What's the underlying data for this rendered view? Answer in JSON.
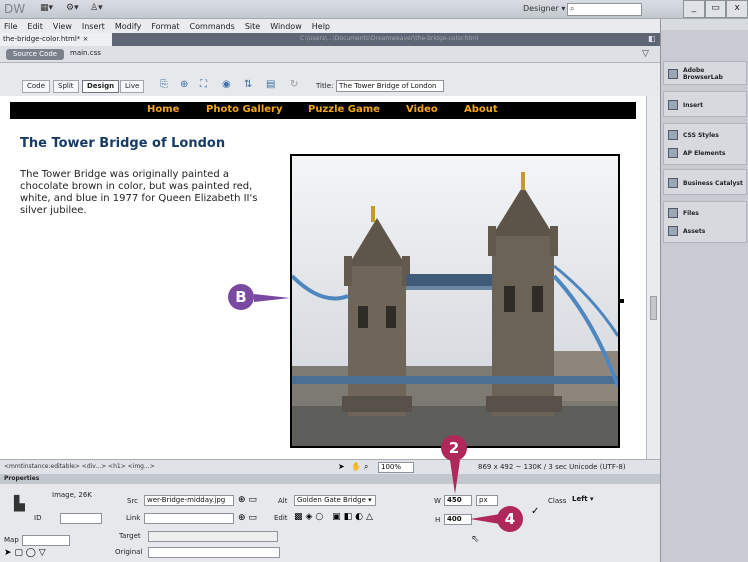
{
  "titlebar": {
    "logo": "DW",
    "designer": "Designer",
    "window_buttons": [
      "_",
      "▭",
      "x"
    ]
  },
  "menu": [
    "File",
    "Edit",
    "View",
    "Insert",
    "Modify",
    "Format",
    "Commands",
    "Site",
    "Window",
    "Help"
  ],
  "doc_tab": "the-bridge-color.html*",
  "related": {
    "source_code": "Source Code",
    "css_file": "main.css"
  },
  "doc_toolbar": {
    "code": "Code",
    "split": "Split",
    "design": "Design",
    "live": "Live",
    "title_label": "Title:",
    "title_value": "The Tower Bridge of London"
  },
  "page": {
    "nav": [
      "Home",
      "Photo Gallery",
      "Puzzle Game",
      "Video",
      "About"
    ],
    "heading": "The Tower Bridge of London",
    "paragraph": "The Tower Bridge was originally painted a chocolate brown in color, but was painted red, white, and blue in 1977 for Queen Elizabeth II's silver jubilee."
  },
  "status": {
    "tags": "<mmtinstance:editable> <div...> <h1> <img...>",
    "zoom": "100%",
    "dimensions": "869 x 492 ~ 130K / 3 sec  Unicode (UTF-8)"
  },
  "properties": {
    "title": "Properties",
    "type_label": "Image, 26K",
    "src_label": "Src",
    "src_value": "wer-Bridge-midday.jpg",
    "alt_label": "Alt",
    "alt_value": "Golden Gate Bridge",
    "id_label": "ID",
    "link_label": "Link",
    "edit_label": "Edit",
    "w_label": "W",
    "w_value": "450",
    "w_unit": "px",
    "h_label": "H",
    "h_value": "400",
    "class_label": "Class",
    "class_value": "Left",
    "map_label": "Map",
    "target_label": "Target",
    "original_label": "Original"
  },
  "right_panel": {
    "items": [
      "Adobe BrowserLab",
      "Insert",
      "CSS Styles",
      "AP Elements",
      "Business Catalyst",
      "Files",
      "Assets"
    ]
  },
  "callouts": {
    "b": "B",
    "two": "2",
    "four": "4"
  },
  "colors": {
    "accent": "#b0285a",
    "nav_text": "#f2a618",
    "heading": "#183a67"
  }
}
